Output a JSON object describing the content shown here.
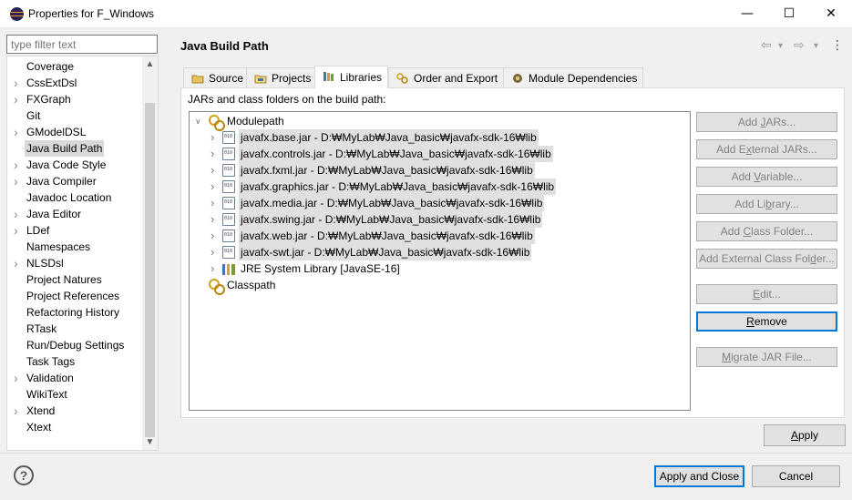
{
  "window": {
    "title": "Properties for F_Windows",
    "minimize_glyph": "—",
    "maximize_glyph": "☐",
    "close_glyph": "✕"
  },
  "filter": {
    "placeholder": "type filter text"
  },
  "nav": {
    "items": [
      {
        "label": "Coverage",
        "expandable": false,
        "selected": false
      },
      {
        "label": "CssExtDsl",
        "expandable": true,
        "selected": false
      },
      {
        "label": "FXGraph",
        "expandable": true,
        "selected": false
      },
      {
        "label": "Git",
        "expandable": false,
        "selected": false
      },
      {
        "label": "GModelDSL",
        "expandable": true,
        "selected": false
      },
      {
        "label": "Java Build Path",
        "expandable": false,
        "selected": true
      },
      {
        "label": "Java Code Style",
        "expandable": true,
        "selected": false
      },
      {
        "label": "Java Compiler",
        "expandable": true,
        "selected": false
      },
      {
        "label": "Javadoc Location",
        "expandable": false,
        "selected": false
      },
      {
        "label": "Java Editor",
        "expandable": true,
        "selected": false
      },
      {
        "label": "LDef",
        "expandable": true,
        "selected": false
      },
      {
        "label": "Namespaces",
        "expandable": false,
        "selected": false
      },
      {
        "label": "NLSDsl",
        "expandable": true,
        "selected": false
      },
      {
        "label": "Project Natures",
        "expandable": false,
        "selected": false
      },
      {
        "label": "Project References",
        "expandable": false,
        "selected": false
      },
      {
        "label": "Refactoring History",
        "expandable": false,
        "selected": false
      },
      {
        "label": "RTask",
        "expandable": false,
        "selected": false
      },
      {
        "label": "Run/Debug Settings",
        "expandable": false,
        "selected": false
      },
      {
        "label": "Task Tags",
        "expandable": false,
        "selected": false
      },
      {
        "label": "Validation",
        "expandable": true,
        "selected": false
      },
      {
        "label": "WikiText",
        "expandable": false,
        "selected": false
      },
      {
        "label": "Xtend",
        "expandable": true,
        "selected": false
      },
      {
        "label": "Xtext",
        "expandable": false,
        "selected": false
      }
    ]
  },
  "page": {
    "title": "Java Build Path",
    "history": {
      "back": "⇦",
      "forward": "⇨",
      "menu": "▾",
      "more": "⋮"
    }
  },
  "tabs": [
    {
      "label": "Source",
      "icon": "source-folder-icon",
      "active": false
    },
    {
      "label": "Projects",
      "icon": "projects-icon",
      "active": false
    },
    {
      "label": "Libraries",
      "icon": "libraries-icon",
      "active": true
    },
    {
      "label": "Order and Export",
      "icon": "order-export-icon",
      "active": false
    },
    {
      "label": "Module Dependencies",
      "icon": "module-dependencies-icon",
      "active": false
    }
  ],
  "libraries": {
    "section_label": "JARs and class folders on the build path:",
    "tree": {
      "modulepath_label": "Modulepath",
      "entries": [
        {
          "label": "javafx.base.jar - D:₩MyLab₩Java_basic₩javafx-sdk-16₩lib",
          "type": "jar"
        },
        {
          "label": "javafx.controls.jar - D:₩MyLab₩Java_basic₩javafx-sdk-16₩lib",
          "type": "jar"
        },
        {
          "label": "javafx.fxml.jar - D:₩MyLab₩Java_basic₩javafx-sdk-16₩lib",
          "type": "jar"
        },
        {
          "label": "javafx.graphics.jar - D:₩MyLab₩Java_basic₩javafx-sdk-16₩lib",
          "type": "jar"
        },
        {
          "label": "javafx.media.jar - D:₩MyLab₩Java_basic₩javafx-sdk-16₩lib",
          "type": "jar"
        },
        {
          "label": "javafx.swing.jar - D:₩MyLab₩Java_basic₩javafx-sdk-16₩lib",
          "type": "jar"
        },
        {
          "label": "javafx.web.jar - D:₩MyLab₩Java_basic₩javafx-sdk-16₩lib",
          "type": "jar"
        },
        {
          "label": "javafx-swt.jar - D:₩MyLab₩Java_basic₩javafx-sdk-16₩lib",
          "type": "jar"
        },
        {
          "label": "JRE System Library [JavaSE-16]",
          "type": "library"
        }
      ],
      "classpath_label": "Classpath"
    },
    "buttons": {
      "add_jars": {
        "pre": "Add ",
        "u": "J",
        "post": "ARs..."
      },
      "add_external_jars": {
        "pre": "Add E",
        "u": "x",
        "post": "ternal JARs..."
      },
      "add_variable": {
        "pre": "Add ",
        "u": "V",
        "post": "ariable..."
      },
      "add_library": {
        "pre": "Add Li",
        "u": "b",
        "post": "rary..."
      },
      "add_class_folder": {
        "pre": "Add ",
        "u": "C",
        "post": "lass Folder..."
      },
      "add_external_class_folder": {
        "pre": "Add External Class Fol",
        "u": "d",
        "post": "er..."
      },
      "edit": {
        "pre": "",
        "u": "E",
        "post": "dit..."
      },
      "remove": {
        "pre": "",
        "u": "R",
        "post": "emove"
      },
      "migrate": {
        "pre": "",
        "u": "M",
        "post": "igrate JAR File..."
      }
    }
  },
  "apply": {
    "pre": "",
    "u": "A",
    "post": "pply"
  },
  "footer": {
    "help": "?",
    "apply_and_close": "Apply and Close",
    "cancel": "Cancel"
  }
}
